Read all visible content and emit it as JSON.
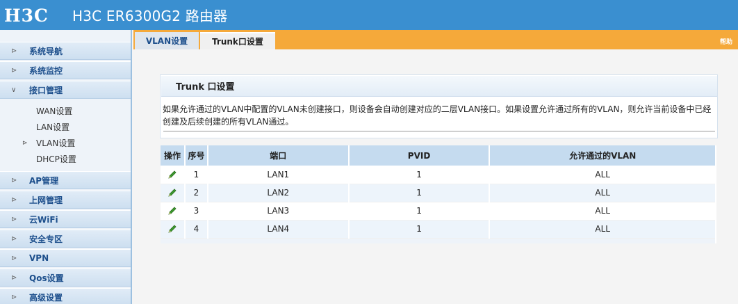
{
  "header": {
    "logo_text": "H3C",
    "title": "H3C ER6300G2 路由器"
  },
  "sidebar": {
    "items": [
      {
        "label": "系统导航"
      },
      {
        "label": "系统监控"
      },
      {
        "label": "接口管理",
        "submenu": [
          {
            "label": "WAN设置"
          },
          {
            "label": "LAN设置"
          },
          {
            "label": "VLAN设置"
          },
          {
            "label": "DHCP设置"
          }
        ]
      },
      {
        "label": "AP管理"
      },
      {
        "label": "上网管理"
      },
      {
        "label": "云WiFi"
      },
      {
        "label": "安全专区"
      },
      {
        "label": "VPN"
      },
      {
        "label": "Qos设置"
      },
      {
        "label": "高级设置"
      }
    ]
  },
  "tabs": [
    {
      "label": "VLAN设置"
    },
    {
      "label": "Trunk口设置"
    }
  ],
  "help_label": "帮助",
  "panel": {
    "title": "Trunk 口设置",
    "description": "如果允许通过的VLAN中配置的VLAN未创建接口，则设备会自动创建对应的二层VLAN接口。如果设置允许通过所有的VLAN，则允许当前设备中已经创建及后续创建的所有VLAN通过。"
  },
  "table": {
    "headers": [
      "操作",
      "序号",
      "端口",
      "PVID",
      "允许通过的VLAN"
    ],
    "rows": [
      {
        "seq": "1",
        "port": "LAN1",
        "pvid": "1",
        "vlan": "ALL"
      },
      {
        "seq": "2",
        "port": "LAN2",
        "pvid": "1",
        "vlan": "ALL"
      },
      {
        "seq": "3",
        "port": "LAN3",
        "pvid": "1",
        "vlan": "ALL"
      },
      {
        "seq": "4",
        "port": "LAN4",
        "pvid": "1",
        "vlan": "ALL"
      }
    ],
    "edit_icon": "pencil-icon"
  },
  "colors": {
    "header_bg": "#3a8fd0",
    "tabbar_bg": "#f5a93a",
    "table_head_bg": "#c5dbef",
    "edit_icon": "#3c9a2e"
  }
}
